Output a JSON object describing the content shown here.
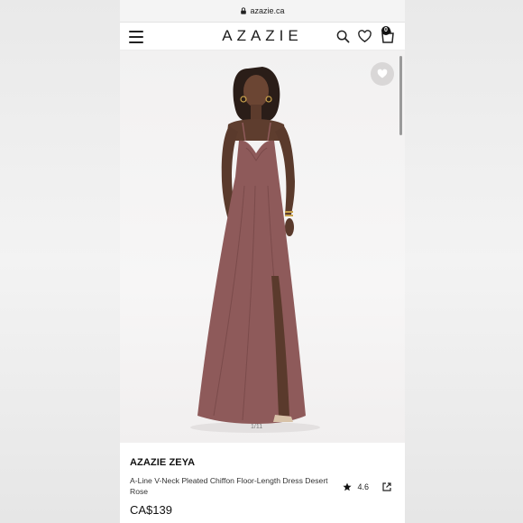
{
  "browser": {
    "url": "azazie.ca"
  },
  "header": {
    "logo": "AZAZIE",
    "cart_count": "0"
  },
  "gallery": {
    "counter": "1/11"
  },
  "product": {
    "brand": "AZAZIE ZEYA",
    "subtitle": "A-Line V-Neck Pleated Chiffon Floor-Length Dress Desert Rose",
    "price": "CA$139",
    "rating": "4.6"
  },
  "colors": {
    "dress": "#8e5a5a",
    "skin": "#5a3a2c"
  }
}
